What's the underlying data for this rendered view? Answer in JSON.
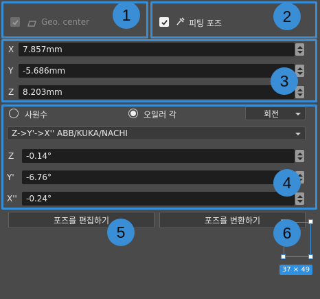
{
  "accent": "#3a8ed6",
  "geo": {
    "label": "Geo. center",
    "checked": true,
    "enabled": false
  },
  "fitting": {
    "label": "피팅 포즈",
    "checked": true
  },
  "position": {
    "x": {
      "label": "X",
      "value": "7.857mm"
    },
    "y": {
      "label": "Y",
      "value": "-5.686mm"
    },
    "z": {
      "label": "Z",
      "value": "8.203mm"
    }
  },
  "rotation": {
    "quaternion_label": "사원수",
    "euler_label": "오일러 각",
    "selected": "euler",
    "mode_select": "회전",
    "convention": "Z->Y'->X'' ABB/KUKA/NACHI",
    "z": {
      "label": "Z",
      "value": "-0.14°"
    },
    "y": {
      "label": "Y'",
      "value": "-6.76°"
    },
    "x": {
      "label": "X''",
      "value": "-0.24°"
    }
  },
  "buttons": {
    "edit_pose": "포즈를 편집하기",
    "transform_pose": "포즈를 변환하기"
  },
  "size_tooltip": "37 × 49",
  "callouts": [
    "1",
    "2",
    "3",
    "4",
    "5",
    "6"
  ]
}
